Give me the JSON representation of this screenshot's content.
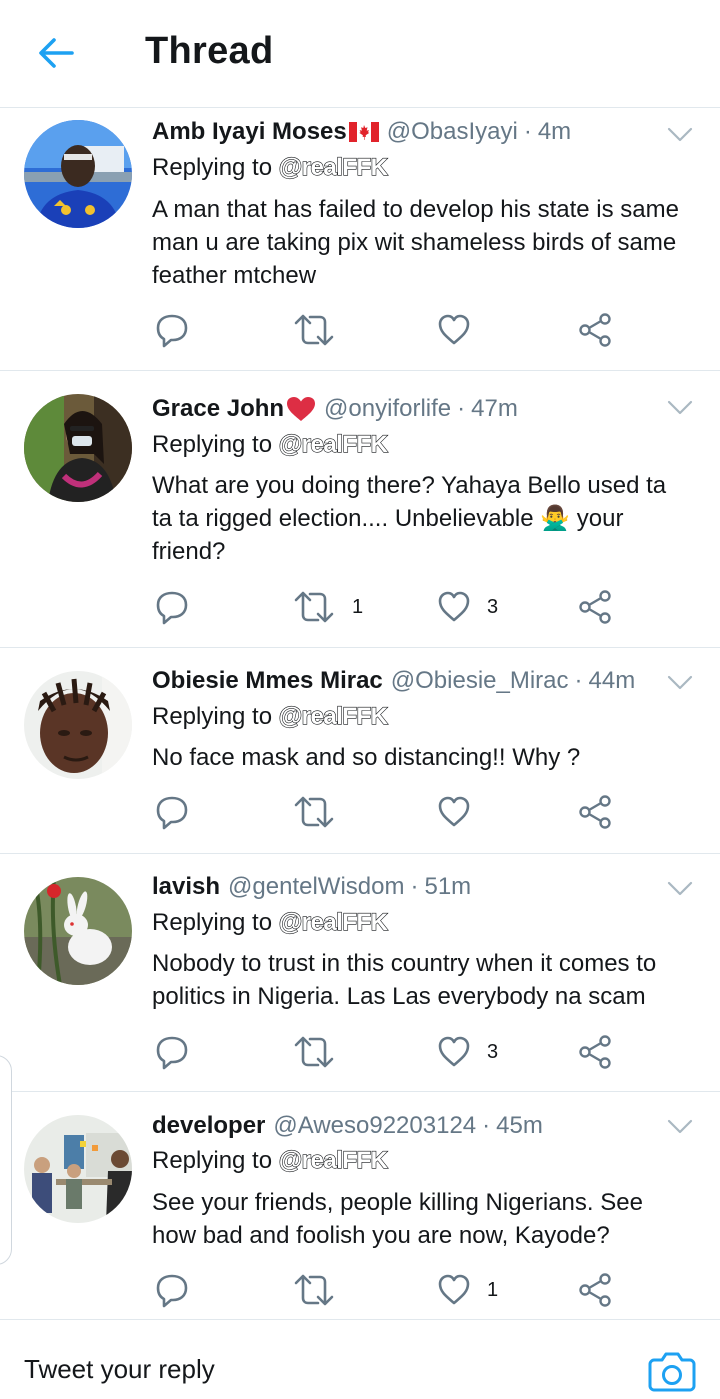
{
  "header": {
    "back_icon": "arrow-left-icon",
    "title": "Thread"
  },
  "colors": {
    "accent": "#1da1f2",
    "secondary_text": "#657786",
    "divider": "#e1e8ed",
    "icon_gray": "#657786"
  },
  "tweets": [
    {
      "name": "Amb Iyayi Moses",
      "name_emoji": "canada-flag-icon",
      "handle": "@ObasIyayi",
      "time": "4m",
      "replying_prefix": "Replying to",
      "mention": "@realFFK",
      "text": "A man that has failed to develop his state is same man u are taking pix wit shameless birds of same feather mtchew",
      "retweets": "",
      "likes": ""
    },
    {
      "name": "Grace John",
      "name_emoji": "red-heart-icon",
      "handle": "@onyiforlife",
      "time": "47m",
      "replying_prefix": "Replying to",
      "mention": "@realFFK",
      "text": "What are you doing there? Yahaya Bello used ta ta ta rigged election.... Unbelievable 🙅‍♂️ your friend?",
      "retweets": "1",
      "likes": "3"
    },
    {
      "name": "Obiesie Mmes Mirac",
      "name_emoji": "",
      "handle": "@Obiesie_Mirac",
      "time": "44m",
      "replying_prefix": "Replying to",
      "mention": "@realFFK",
      "text": "No face mask and so distancing!! Why ?",
      "retweets": "",
      "likes": ""
    },
    {
      "name": "lavish",
      "name_emoji": "",
      "handle": "@gentelWisdom",
      "time": "51m",
      "replying_prefix": "Replying to",
      "mention": "@realFFK",
      "text": "Nobody to trust in this country when it comes to politics in Nigeria. Las Las everybody na scam",
      "retweets": "",
      "likes": "3"
    },
    {
      "name": "developer",
      "name_emoji": "",
      "handle": "@Aweso92203124",
      "time": "45m",
      "replying_prefix": "Replying to",
      "mention": "@realFFK",
      "text": "See your friends, people killing Nigerians. See how bad and foolish you are now, Kayode?",
      "retweets": "",
      "likes": "1"
    }
  ],
  "separator": "·",
  "composer": {
    "placeholder": "Tweet your reply",
    "camera_icon": "camera-icon"
  }
}
